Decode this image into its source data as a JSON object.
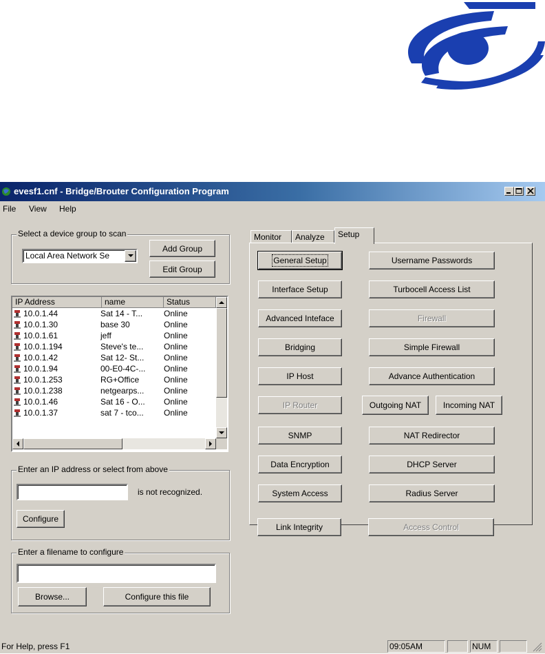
{
  "window": {
    "title": "evesf1.cnf - Bridge/Brouter Configuration Program"
  },
  "menu": [
    "File",
    "View",
    "Help"
  ],
  "scan_group": {
    "label": "Select a device group to scan",
    "selected": "Local Area Network Se",
    "add_group": "Add Group",
    "edit_group": "Edit Group"
  },
  "device_list": {
    "columns": [
      "IP Address",
      "name",
      "Status"
    ],
    "rows": [
      {
        "ip": "10.0.1.44",
        "name": "Sat 14 - T...",
        "status": "Online"
      },
      {
        "ip": "10.0.1.30",
        "name": "base 30",
        "status": "Online"
      },
      {
        "ip": "10.0.1.61",
        "name": "jeff",
        "status": "Online"
      },
      {
        "ip": "10.0.1.194",
        "name": "Steve's te...",
        "status": "Online"
      },
      {
        "ip": "10.0.1.42",
        "name": "Sat 12- St...",
        "status": "Online"
      },
      {
        "ip": "10.0.1.94",
        "name": "00-E0-4C-...",
        "status": "Online"
      },
      {
        "ip": "10.0.1.253",
        "name": "RG+Office",
        "status": "Online"
      },
      {
        "ip": "10.0.1.238",
        "name": "netgearps...",
        "status": "Online"
      },
      {
        "ip": "10.0.1.46",
        "name": "Sat 16 - O...",
        "status": "Online"
      },
      {
        "ip": "10.0.1.37",
        "name": "sat 7 - tco...",
        "status": "Online"
      }
    ]
  },
  "ip_entry": {
    "label": "Enter an IP address or select from above",
    "value": "",
    "message": "is not recognized.",
    "configure": "Configure"
  },
  "file_entry": {
    "label": "Enter a filename to configure",
    "value": "",
    "browse": "Browse...",
    "configure_file": "Configure this file"
  },
  "tabs": [
    "Monitor",
    "Analyze",
    "Setup"
  ],
  "active_tab": "Setup",
  "setup_buttons": {
    "general_setup": "General Setup",
    "interface_setup": "Interface Setup",
    "advanced_inteface": "Advanced Inteface",
    "bridging": "Bridging",
    "ip_host": "IP Host",
    "ip_router": "IP Router",
    "snmp": "SNMP",
    "data_encryption": "Data Encryption",
    "system_access": "System Access",
    "link_integrity": "Link Integrity",
    "username_passwords": "Username Passwords",
    "turbocell_access_list": "Turbocell Access List",
    "firewall": "Firewall",
    "simple_firewall": "Simple Firewall",
    "advance_authentication": "Advance Authentication",
    "outgoing_nat": "Outgoing NAT",
    "incoming_nat": "Incoming NAT",
    "nat_redirector": "NAT Redirector",
    "dhcp_server": "DHCP Server",
    "radius_server": "Radius Server",
    "access_control": "Access Control"
  },
  "statusbar": {
    "help": "For Help, press F1",
    "time": "09:05AM",
    "num": "NUM"
  },
  "colors": {
    "title_gradient_start": "#0a246a",
    "title_gradient_end": "#a6caf0",
    "logo_blue": "#1a3fb0",
    "face": "#d4d0c8"
  }
}
